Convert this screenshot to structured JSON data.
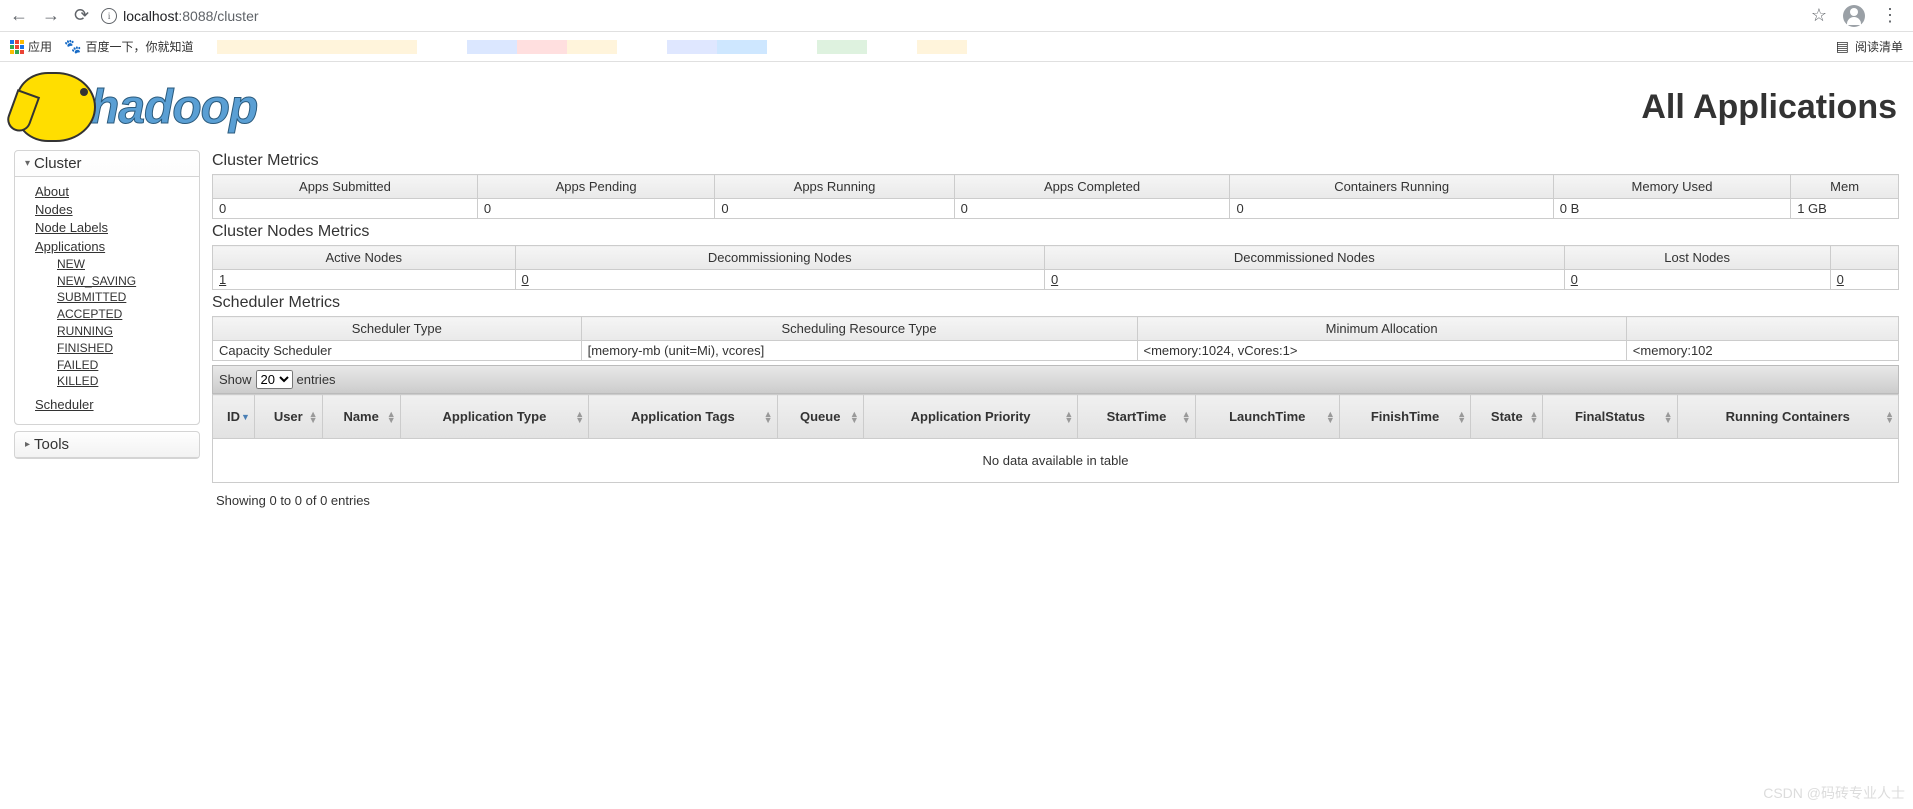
{
  "browser": {
    "url_host": "localhost",
    "url_port_path": ":8088/cluster",
    "bookmarks_apps": "应用",
    "bookmark_baidu": "百度一下，你就知道",
    "reading_list": "阅读清单"
  },
  "header": {
    "logo_text": "hadoop",
    "page_title": "All Applications"
  },
  "sidebar": {
    "cluster_label": "Cluster",
    "tools_label": "Tools",
    "links": {
      "about": "About",
      "nodes": "Nodes",
      "node_labels": "Node Labels",
      "applications": "Applications",
      "scheduler": "Scheduler"
    },
    "app_states": [
      "NEW",
      "NEW_SAVING",
      "SUBMITTED",
      "ACCEPTED",
      "RUNNING",
      "FINISHED",
      "FAILED",
      "KILLED"
    ]
  },
  "cluster_metrics": {
    "title": "Cluster Metrics",
    "headers": [
      "Apps Submitted",
      "Apps Pending",
      "Apps Running",
      "Apps Completed",
      "Containers Running",
      "Memory Used",
      "Mem"
    ],
    "values": [
      "0",
      "0",
      "0",
      "0",
      "0",
      "0 B",
      "1 GB"
    ]
  },
  "cluster_nodes_metrics": {
    "title": "Cluster Nodes Metrics",
    "headers": [
      "Active Nodes",
      "Decommissioning Nodes",
      "Decommissioned Nodes",
      "Lost Nodes",
      ""
    ],
    "values": [
      "1",
      "0",
      "0",
      "0",
      "0"
    ]
  },
  "scheduler_metrics": {
    "title": "Scheduler Metrics",
    "headers": [
      "Scheduler Type",
      "Scheduling Resource Type",
      "Minimum Allocation",
      ""
    ],
    "values": [
      "Capacity Scheduler",
      "[memory-mb (unit=Mi), vcores]",
      "<memory:1024, vCores:1>",
      "<memory:102"
    ]
  },
  "apps_table": {
    "show_label": "Show",
    "show_value": "20",
    "entries_label": "entries",
    "headers": [
      "ID",
      "User",
      "Name",
      "Application Type",
      "Application Tags",
      "Queue",
      "Application Priority",
      "StartTime",
      "LaunchTime",
      "FinishTime",
      "State",
      "FinalStatus",
      "Running Containers"
    ],
    "no_data": "No data available in table",
    "footer": "Showing 0 to 0 of 0 entries"
  },
  "watermark": "CSDN @码砖专业人士"
}
